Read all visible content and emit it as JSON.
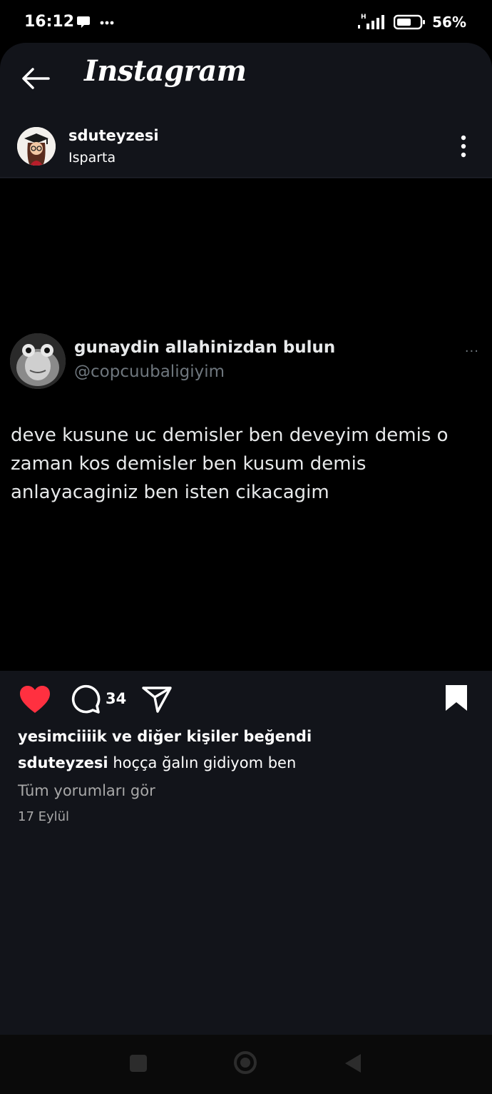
{
  "status_bar": {
    "time": "16:12",
    "network": "H",
    "battery": "56%"
  },
  "header": {
    "title": "Instagram",
    "back_icon": "arrow-left-icon"
  },
  "post": {
    "username": "sduteyzesi",
    "location": "Isparta",
    "tweet": {
      "display_name": "gunaydin allahinizdan bulun",
      "handle": "@copcuubaligiyim",
      "more": "···",
      "text": "deve kusune uc demisler ben deveyim demis o zaman kos demisler ben kusum demis anlayacaginiz ben isten cikacagim"
    },
    "comment_count": "34",
    "likes_text": "yesimciiiik ve diğer kişiler beğendi",
    "caption_user": "sduteyzesi",
    "caption_text": "hoççа ğalın gidiyom ben",
    "view_comments": "Tüm yorumları gör",
    "date": "17 Eylül",
    "liked": true,
    "saved": true
  },
  "colors": {
    "background": "#12141a",
    "like_red": "#ff3040",
    "muted": "#a8a8a8"
  }
}
